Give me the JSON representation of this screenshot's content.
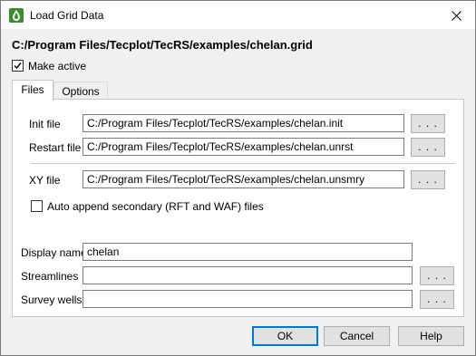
{
  "window": {
    "title": "Load Grid Data",
    "icon": "tecplot-droplet-icon",
    "close_icon": "close-icon"
  },
  "header": {
    "path": "C:/Program Files/Tecplot/TecRS/examples/chelan.grid"
  },
  "make_active": {
    "label": "Make active",
    "checked": true
  },
  "tabs": [
    {
      "label": "Files",
      "active": true
    },
    {
      "label": "Options",
      "active": false
    }
  ],
  "files": {
    "init": {
      "label": "Init file",
      "value": "C:/Program Files/Tecplot/TecRS/examples/chelan.init",
      "browse": ". . ."
    },
    "restart": {
      "label": "Restart file",
      "value": "C:/Program Files/Tecplot/TecRS/examples/chelan.unrst",
      "browse": ". . ."
    },
    "xy": {
      "label": "XY file",
      "value": "C:/Program Files/Tecplot/TecRS/examples/chelan.unsmry",
      "browse": ". . ."
    },
    "auto_append": {
      "label": "Auto append secondary (RFT and WAF) files",
      "checked": false
    },
    "display_name": {
      "label": "Display name",
      "value": "chelan"
    },
    "streamlines": {
      "label": "Streamlines",
      "value": "",
      "browse": ". . ."
    },
    "survey_wells": {
      "label": "Survey wells",
      "value": "",
      "browse": ". . ."
    }
  },
  "buttons": {
    "ok": "OK",
    "cancel": "Cancel",
    "help": "Help"
  },
  "colors": {
    "focus_border": "#0078d7",
    "icon_green": "#3a8d2f"
  }
}
